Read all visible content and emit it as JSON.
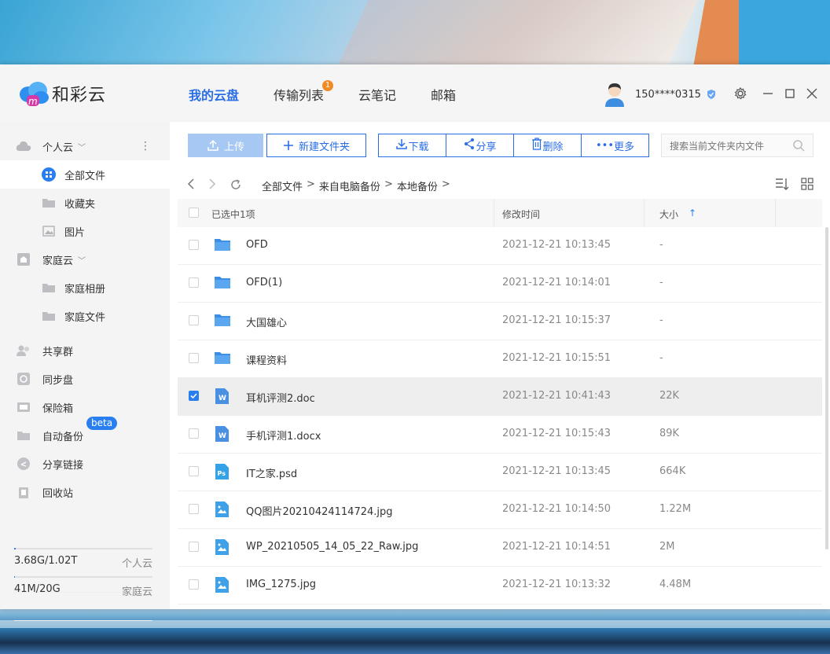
{
  "app": {
    "name": "和彩云"
  },
  "nav": [
    {
      "label": "我的云盘",
      "active": true
    },
    {
      "label": "传输列表",
      "badge": "1"
    },
    {
      "label": "云笔记"
    },
    {
      "label": "邮箱"
    }
  ],
  "user": {
    "phone": "150****0315"
  },
  "sidebar": {
    "personal_cloud": "个人云",
    "all_files": "全部文件",
    "favorites": "收藏夹",
    "photos": "图片",
    "family_cloud": "家庭云",
    "family_album": "家庭相册",
    "family_files": "家庭文件",
    "shared_group": "共享群",
    "sync_disk": "同步盘",
    "safe_box": "保险箱",
    "auto_backup": "自动备份",
    "beta": "beta",
    "share_links": "分享链接",
    "recycle_bin": "回收站"
  },
  "storage": {
    "personal": {
      "used": "3.68G/1.02T",
      "label": "个人云",
      "fraction": 0.0035
    },
    "family": {
      "used": "41M/20G",
      "label": "家庭云",
      "fraction": 0.002
    }
  },
  "toolbar": {
    "upload": "上传",
    "new_folder": "新建文件夹",
    "download": "下载",
    "share": "分享",
    "delete": "删除",
    "more": "更多",
    "search_placeholder": "搜索当前文件夹内文件"
  },
  "breadcrumb": [
    "全部文件",
    "来自电脑备份",
    "本地备份"
  ],
  "table": {
    "selected_label": "已选中1项",
    "col_time": "修改时间",
    "col_size": "大小",
    "sort_arrow": "↑"
  },
  "files": [
    {
      "name": "OFD",
      "time": "2021-12-21 10:13:45",
      "size": "-",
      "type": "folder"
    },
    {
      "name": "OFD(1)",
      "time": "2021-12-21 10:14:01",
      "size": "-",
      "type": "folder"
    },
    {
      "name": "大国雄心",
      "time": "2021-12-21 10:15:37",
      "size": "-",
      "type": "folder"
    },
    {
      "name": "课程资料",
      "time": "2021-12-21 10:15:51",
      "size": "-",
      "type": "folder"
    },
    {
      "name": "耳机评测2.doc",
      "time": "2021-12-21 10:41:43",
      "size": "22K",
      "type": "word",
      "selected": true
    },
    {
      "name": "手机评测1.docx",
      "time": "2021-12-21 10:15:43",
      "size": "89K",
      "type": "word"
    },
    {
      "name": "IT之家.psd",
      "time": "2021-12-21 10:13:45",
      "size": "664K",
      "type": "psd"
    },
    {
      "name": "QQ图片20210424114724.jpg",
      "time": "2021-12-21 10:14:50",
      "size": "1.22M",
      "type": "image"
    },
    {
      "name": "WP_20210505_14_05_22_Raw.jpg",
      "time": "2021-12-21 10:14:51",
      "size": "2M",
      "type": "image"
    },
    {
      "name": "IMG_1275.jpg",
      "time": "2021-12-21 10:13:32",
      "size": "4.48M",
      "type": "image"
    }
  ],
  "icons": {
    "folder": "folder-icon",
    "word": "word-file-icon",
    "psd": "psd-file-icon",
    "image": "image-file-icon"
  },
  "colors": {
    "accent": "#2a6ee6",
    "upload_disabled": "#a6c8f2",
    "badge": "#f08a24",
    "folder": "#4a90e2"
  }
}
